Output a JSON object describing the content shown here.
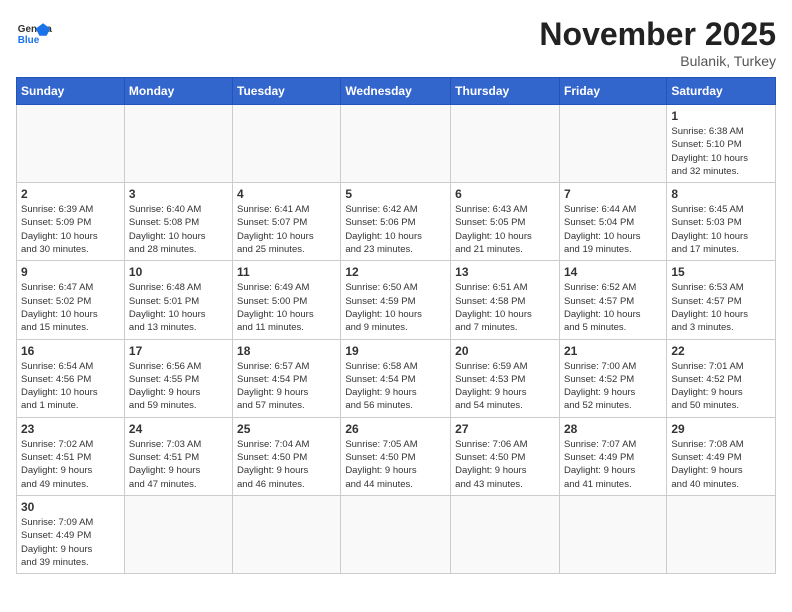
{
  "header": {
    "logo_general": "General",
    "logo_blue": "Blue",
    "month_title": "November 2025",
    "location": "Bulanik, Turkey"
  },
  "weekdays": [
    "Sunday",
    "Monday",
    "Tuesday",
    "Wednesday",
    "Thursday",
    "Friday",
    "Saturday"
  ],
  "weeks": [
    [
      {
        "day": "",
        "info": ""
      },
      {
        "day": "",
        "info": ""
      },
      {
        "day": "",
        "info": ""
      },
      {
        "day": "",
        "info": ""
      },
      {
        "day": "",
        "info": ""
      },
      {
        "day": "",
        "info": ""
      },
      {
        "day": "1",
        "info": "Sunrise: 6:38 AM\nSunset: 5:10 PM\nDaylight: 10 hours\nand 32 minutes."
      }
    ],
    [
      {
        "day": "2",
        "info": "Sunrise: 6:39 AM\nSunset: 5:09 PM\nDaylight: 10 hours\nand 30 minutes."
      },
      {
        "day": "3",
        "info": "Sunrise: 6:40 AM\nSunset: 5:08 PM\nDaylight: 10 hours\nand 28 minutes."
      },
      {
        "day": "4",
        "info": "Sunrise: 6:41 AM\nSunset: 5:07 PM\nDaylight: 10 hours\nand 25 minutes."
      },
      {
        "day": "5",
        "info": "Sunrise: 6:42 AM\nSunset: 5:06 PM\nDaylight: 10 hours\nand 23 minutes."
      },
      {
        "day": "6",
        "info": "Sunrise: 6:43 AM\nSunset: 5:05 PM\nDaylight: 10 hours\nand 21 minutes."
      },
      {
        "day": "7",
        "info": "Sunrise: 6:44 AM\nSunset: 5:04 PM\nDaylight: 10 hours\nand 19 minutes."
      },
      {
        "day": "8",
        "info": "Sunrise: 6:45 AM\nSunset: 5:03 PM\nDaylight: 10 hours\nand 17 minutes."
      }
    ],
    [
      {
        "day": "9",
        "info": "Sunrise: 6:47 AM\nSunset: 5:02 PM\nDaylight: 10 hours\nand 15 minutes."
      },
      {
        "day": "10",
        "info": "Sunrise: 6:48 AM\nSunset: 5:01 PM\nDaylight: 10 hours\nand 13 minutes."
      },
      {
        "day": "11",
        "info": "Sunrise: 6:49 AM\nSunset: 5:00 PM\nDaylight: 10 hours\nand 11 minutes."
      },
      {
        "day": "12",
        "info": "Sunrise: 6:50 AM\nSunset: 4:59 PM\nDaylight: 10 hours\nand 9 minutes."
      },
      {
        "day": "13",
        "info": "Sunrise: 6:51 AM\nSunset: 4:58 PM\nDaylight: 10 hours\nand 7 minutes."
      },
      {
        "day": "14",
        "info": "Sunrise: 6:52 AM\nSunset: 4:57 PM\nDaylight: 10 hours\nand 5 minutes."
      },
      {
        "day": "15",
        "info": "Sunrise: 6:53 AM\nSunset: 4:57 PM\nDaylight: 10 hours\nand 3 minutes."
      }
    ],
    [
      {
        "day": "16",
        "info": "Sunrise: 6:54 AM\nSunset: 4:56 PM\nDaylight: 10 hours\nand 1 minute."
      },
      {
        "day": "17",
        "info": "Sunrise: 6:56 AM\nSunset: 4:55 PM\nDaylight: 9 hours\nand 59 minutes."
      },
      {
        "day": "18",
        "info": "Sunrise: 6:57 AM\nSunset: 4:54 PM\nDaylight: 9 hours\nand 57 minutes."
      },
      {
        "day": "19",
        "info": "Sunrise: 6:58 AM\nSunset: 4:54 PM\nDaylight: 9 hours\nand 56 minutes."
      },
      {
        "day": "20",
        "info": "Sunrise: 6:59 AM\nSunset: 4:53 PM\nDaylight: 9 hours\nand 54 minutes."
      },
      {
        "day": "21",
        "info": "Sunrise: 7:00 AM\nSunset: 4:52 PM\nDaylight: 9 hours\nand 52 minutes."
      },
      {
        "day": "22",
        "info": "Sunrise: 7:01 AM\nSunset: 4:52 PM\nDaylight: 9 hours\nand 50 minutes."
      }
    ],
    [
      {
        "day": "23",
        "info": "Sunrise: 7:02 AM\nSunset: 4:51 PM\nDaylight: 9 hours\nand 49 minutes."
      },
      {
        "day": "24",
        "info": "Sunrise: 7:03 AM\nSunset: 4:51 PM\nDaylight: 9 hours\nand 47 minutes."
      },
      {
        "day": "25",
        "info": "Sunrise: 7:04 AM\nSunset: 4:50 PM\nDaylight: 9 hours\nand 46 minutes."
      },
      {
        "day": "26",
        "info": "Sunrise: 7:05 AM\nSunset: 4:50 PM\nDaylight: 9 hours\nand 44 minutes."
      },
      {
        "day": "27",
        "info": "Sunrise: 7:06 AM\nSunset: 4:50 PM\nDaylight: 9 hours\nand 43 minutes."
      },
      {
        "day": "28",
        "info": "Sunrise: 7:07 AM\nSunset: 4:49 PM\nDaylight: 9 hours\nand 41 minutes."
      },
      {
        "day": "29",
        "info": "Sunrise: 7:08 AM\nSunset: 4:49 PM\nDaylight: 9 hours\nand 40 minutes."
      }
    ],
    [
      {
        "day": "30",
        "info": "Sunrise: 7:09 AM\nSunset: 4:49 PM\nDaylight: 9 hours\nand 39 minutes."
      },
      {
        "day": "",
        "info": ""
      },
      {
        "day": "",
        "info": ""
      },
      {
        "day": "",
        "info": ""
      },
      {
        "day": "",
        "info": ""
      },
      {
        "day": "",
        "info": ""
      },
      {
        "day": "",
        "info": ""
      }
    ]
  ]
}
